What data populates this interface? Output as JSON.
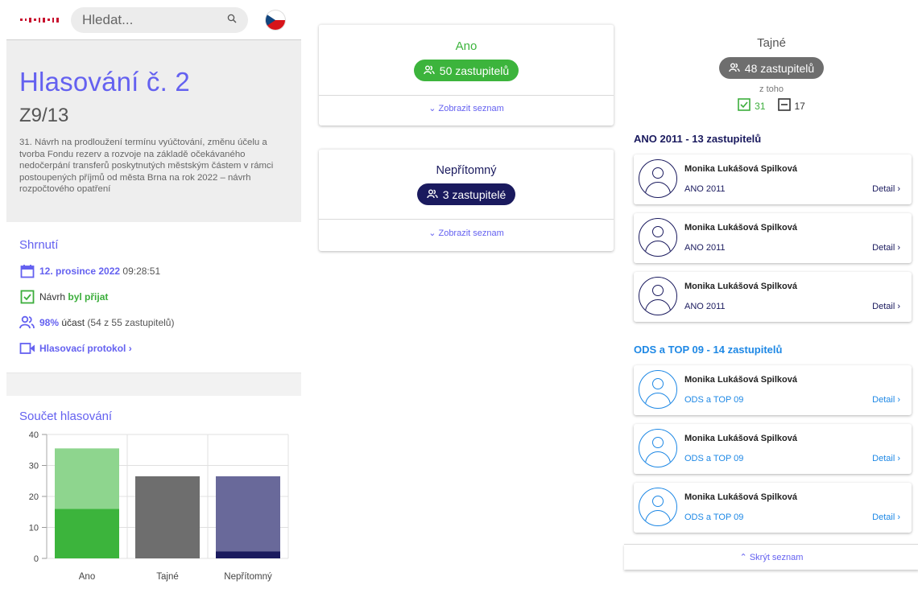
{
  "header": {
    "search_placeholder": "Hledat..."
  },
  "vote": {
    "title": "Hlasování č. 2",
    "code": "Z9/13",
    "description": "31.  Návrh na prodloužení termínu vyúčtování, změnu účelu a tvorba Fondu  rezerv a rozvoje na základě očekávaného nedočerpání transferů  poskytnutých městským částem v rámci postoupených příjmů od města Brna na rok 2022 – návrh rozpočtového opatření"
  },
  "summary": {
    "title": "Shrnutí",
    "date": "12. prosince 2022",
    "time": "09:28:51",
    "result_prefix": "Návrh",
    "result_value": "byl přijat",
    "participation_pct": "98%",
    "participation_word": "účast",
    "participation_detail": "(54 z 55 zastupitelů)",
    "protocol_link": "Hlasovací protokol ›"
  },
  "chart_title": "Součet hlasování",
  "chart_data": {
    "type": "bar",
    "stacked": true,
    "categories": [
      "Ano",
      "Tajné",
      "Nepřítomný"
    ],
    "series": [
      {
        "name": "",
        "values": [
          16,
          26.5,
          2.3
        ],
        "colors": [
          "#3cb43c",
          "#6e6e6e",
          "#1a1a5e"
        ]
      },
      {
        "name": "",
        "values": [
          19.5,
          0,
          24.2
        ],
        "colors": [
          "#8ed58e",
          "#6e6e6e",
          "#69699a"
        ]
      }
    ],
    "ylim": [
      0,
      40
    ],
    "yticks": [
      0,
      10,
      20,
      30,
      40
    ],
    "grid": true
  },
  "cards": {
    "ano": {
      "title": "Ano",
      "count": "50 zastupitelů",
      "link": "⌄ Zobrazit seznam",
      "color": "#3cb43c"
    },
    "nepritomny": {
      "title": "Nepřítomný",
      "count": "3 zastupitelé",
      "link": "⌄ Zobrazit seznam",
      "color": "#1a1a5e"
    }
  },
  "tajne": {
    "title": "Tajné",
    "count": "48 zastupitelů",
    "z_toho": "z toho",
    "yes_count": "31",
    "abstain_count": "17",
    "hide_link": "⌃ Skrýt seznam"
  },
  "groups": [
    {
      "title": "ANO 2011 - 13 zastupitelů",
      "color": "#1a1a5e",
      "members": [
        {
          "name": "Monika Lukášová Spilková",
          "party": "ANO 2011",
          "detail": "Detail ›"
        },
        {
          "name": "Monika Lukášová Spilková",
          "party": "ANO 2011",
          "detail": "Detail ›"
        },
        {
          "name": "Monika Lukášová Spilková",
          "party": "ANO 2011",
          "detail": "Detail ›"
        }
      ]
    },
    {
      "title": "ODS a TOP 09 - 14 zastupitelů",
      "color": "#1e88e5",
      "members": [
        {
          "name": "Monika Lukášová Spilková",
          "party": "ODS a TOP 09",
          "detail": "Detail ›"
        },
        {
          "name": "Monika Lukášová Spilková",
          "party": "ODS a TOP 09",
          "detail": "Detail ›"
        },
        {
          "name": "Monika Lukášová Spilková",
          "party": "ODS a TOP 09",
          "detail": "Detail ›"
        }
      ]
    }
  ]
}
